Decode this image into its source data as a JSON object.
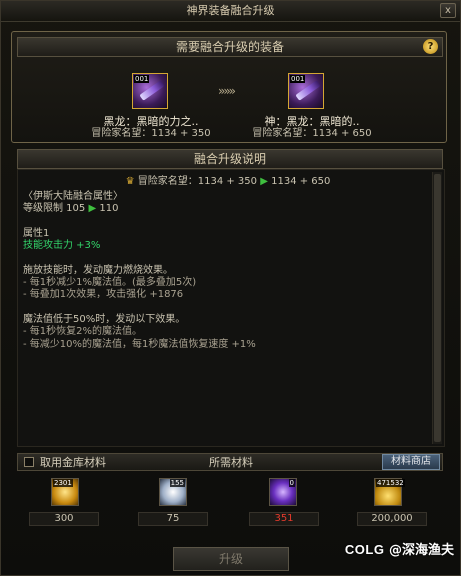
{
  "window": {
    "title": "神界装备融合升级",
    "close_label": "x"
  },
  "equip_section": {
    "title": "需要融合升级的装备",
    "help_label": "?",
    "source": {
      "name": "黑龙：黑暗的力之..",
      "reputation": "冒险家名望：1134 + 350",
      "level_badge": "001"
    },
    "target": {
      "name": "神：黑龙：黑暗的..",
      "reputation": "冒险家名望：1134 + 650",
      "level_badge": "001"
    },
    "arrows": "»»»"
  },
  "desc_section": {
    "title": "融合升级说明",
    "reputation_label": "冒险家名望：1134 + 350",
    "reputation_arrow": "▶",
    "reputation_new": "1134 + 650",
    "region_attr": "〈伊斯大陆融合属性〉",
    "level_label": "等级限制 105",
    "level_new": "110",
    "attr_title": "属性1",
    "skill_atk": "技能攻击力 +3%",
    "effect1_title": "施放技能时，发动魔力燃烧效果。",
    "effect1_line1": "- 每1秒减少1%魔法值。(最多叠加5次)",
    "effect1_line2": "- 每叠加1次效果，攻击强化 +1876",
    "effect2_title": "魔法值低于50%时，发动以下效果。",
    "effect2_line1": "- 每1秒恢复2%的魔法值。",
    "effect2_line2": "- 每减少10%的魔法值，每1秒魔法值恢复速度 +1%"
  },
  "materials": {
    "checkbox_label": "取用金库材料",
    "title": "所需材料",
    "shop_button": "材料商店",
    "items": [
      {
        "icon": "gold-crystal-icon",
        "count": "2301",
        "required": "300",
        "color": "#e7b320",
        "insufficient": false
      },
      {
        "icon": "white-orb-icon",
        "count": "155",
        "required": "75",
        "color": "#cfd8e6",
        "insufficient": false
      },
      {
        "icon": "purple-orb-icon",
        "count": "0",
        "required": "351",
        "color": "#8a4fd6",
        "insufficient": true
      },
      {
        "icon": "gold-coins-icon",
        "count": "471532",
        "required": "200,000",
        "color": "#f0c030",
        "insufficient": false
      }
    ]
  },
  "upgrade_button": "升级",
  "watermark": {
    "brand": "COLG",
    "at": "@",
    "user": "深海渔夫"
  }
}
